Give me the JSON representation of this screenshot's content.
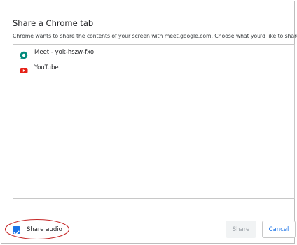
{
  "dialog": {
    "title": "Share a Chrome tab",
    "subtitle": "Chrome wants to share the contents of your screen with meet.google.com. Choose what you'd like to share."
  },
  "tabs": [
    {
      "label": "Meet - yok-hszw-fxo",
      "icon": "google-meet-icon",
      "icon_color": "#00897b"
    },
    {
      "label": "YouTube",
      "icon": "youtube-icon",
      "icon_color": "#e62117"
    }
  ],
  "footer": {
    "share_audio_label": "Share audio",
    "share_audio_checked": true,
    "share_label": "Share",
    "cancel_label": "Cancel"
  },
  "colors": {
    "accent": "#1a73e8",
    "annotation": "#c62828"
  }
}
